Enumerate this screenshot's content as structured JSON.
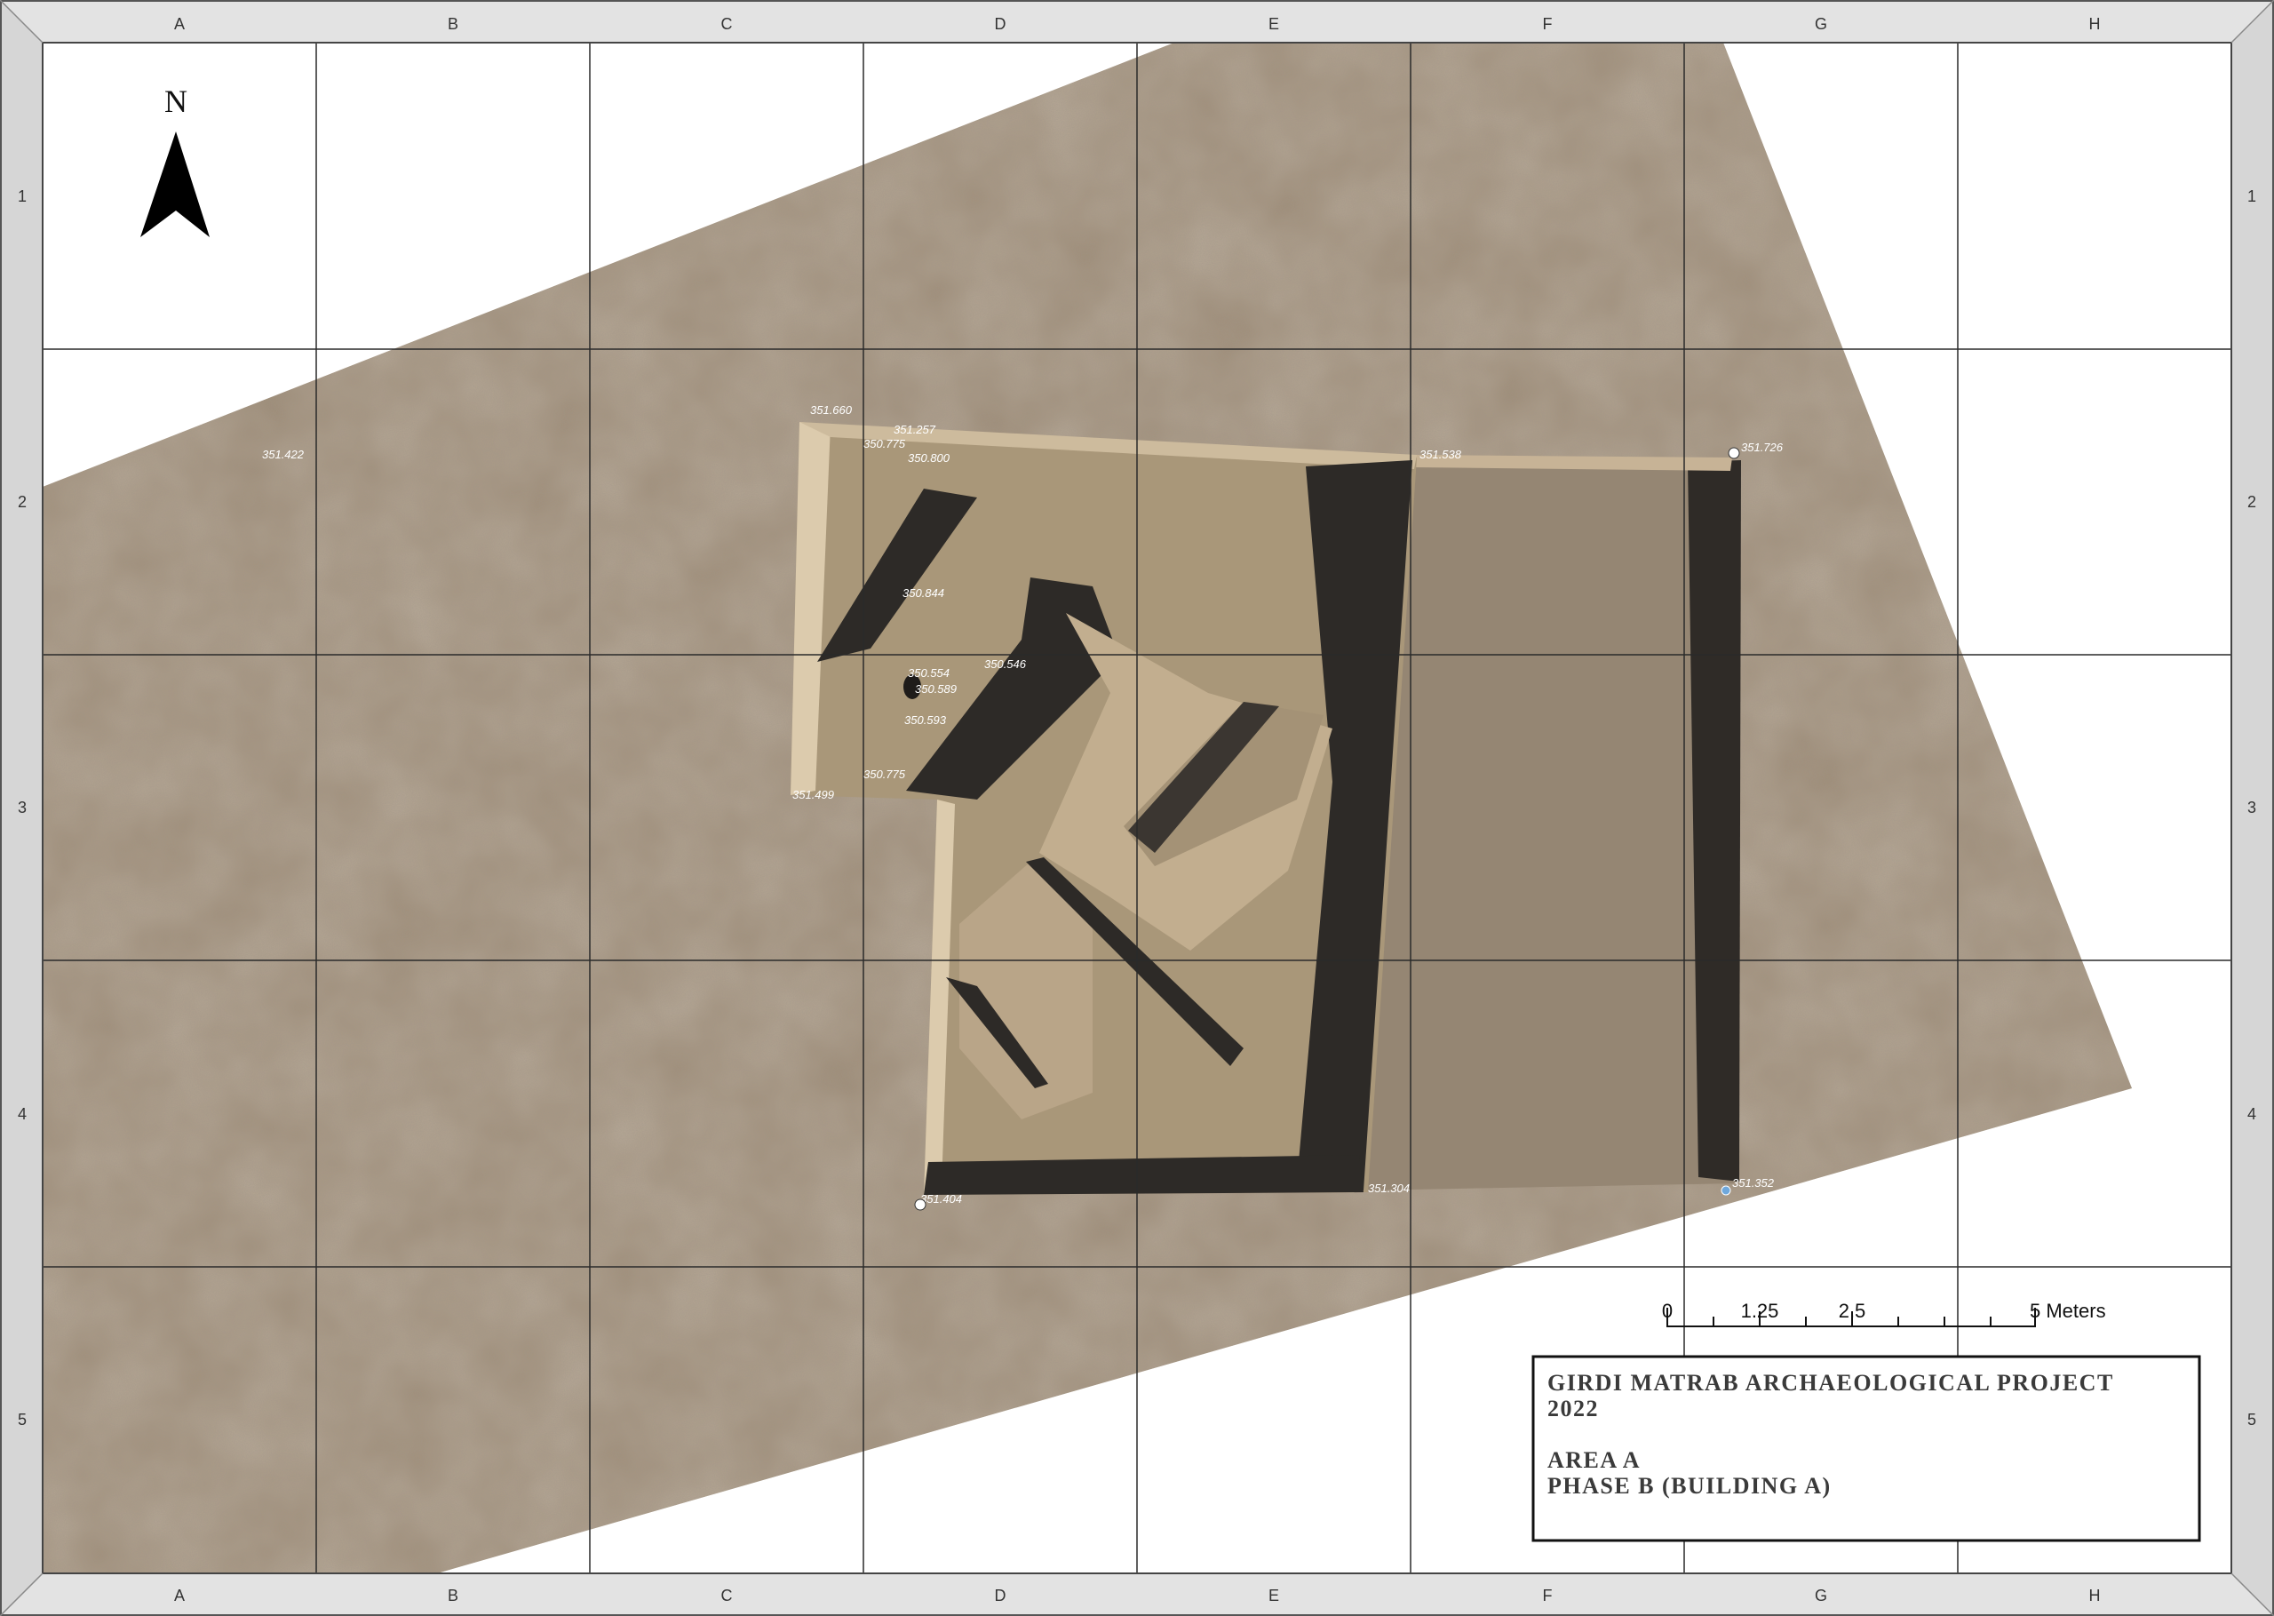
{
  "frame": {
    "columns": [
      "A",
      "B",
      "C",
      "D",
      "E",
      "F",
      "G",
      "H"
    ],
    "rows": [
      "1",
      "2",
      "3",
      "4",
      "5"
    ]
  },
  "north_arrow": {
    "label": "N"
  },
  "scale_bar": {
    "labels": [
      "0",
      "1.25",
      "2.5",
      "5 Meters"
    ]
  },
  "title_block": {
    "project": "GIRDI MATRAB ARCHAEOLOGICAL PROJECT",
    "year": "2022",
    "area": "AREA A",
    "phase": "PHASE B (BUILDING A)"
  },
  "elevations": [
    {
      "id": "e1",
      "label": "351.422"
    },
    {
      "id": "e2",
      "label": "351.660"
    },
    {
      "id": "e3",
      "label": "351.257"
    },
    {
      "id": "e4",
      "label": "350.775"
    },
    {
      "id": "e5",
      "label": "350.800"
    },
    {
      "id": "e6",
      "label": "351.538"
    },
    {
      "id": "e7",
      "label": "351.726"
    },
    {
      "id": "e8",
      "label": "350.844"
    },
    {
      "id": "e9",
      "label": "350.546"
    },
    {
      "id": "e10",
      "label": "350.554"
    },
    {
      "id": "e11",
      "label": "350.589"
    },
    {
      "id": "e12",
      "label": "350.593"
    },
    {
      "id": "e13",
      "label": "350.775"
    },
    {
      "id": "e14",
      "label": "351.499"
    },
    {
      "id": "e15",
      "label": "351.404"
    },
    {
      "id": "e16",
      "label": "351.304"
    },
    {
      "id": "e17",
      "label": "351.352"
    }
  ],
  "colors": {
    "ground": "#9c8a74",
    "trench_wall": "#d2c1a6",
    "shadow": "#2d2a27",
    "frame_border": "#e0e0e0",
    "grid_line": "#2a2a2a"
  }
}
